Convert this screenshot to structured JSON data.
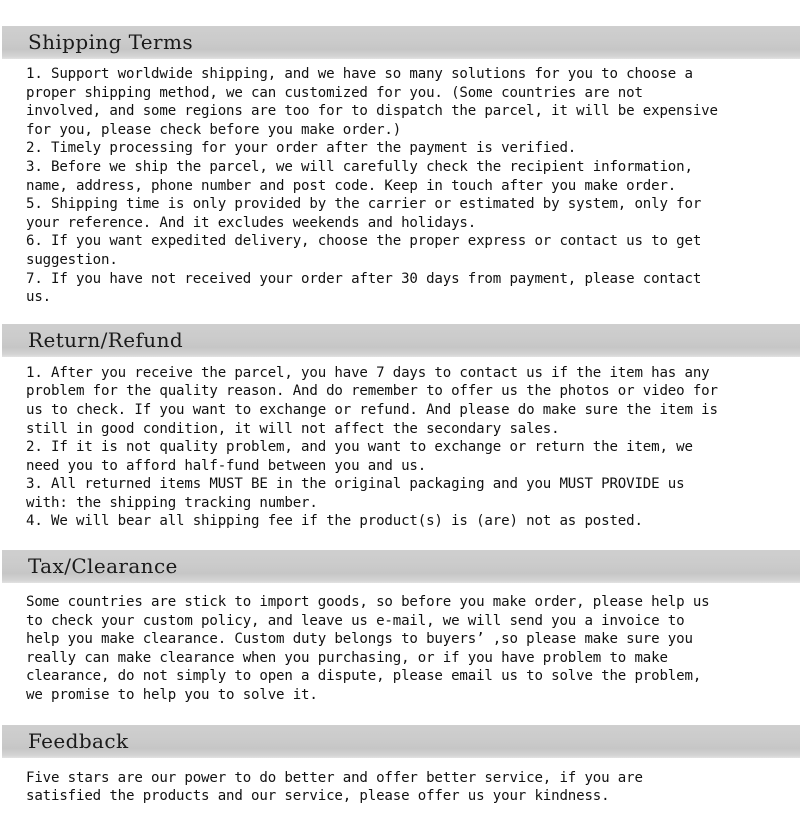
{
  "document": {
    "background_color": "#ffffff",
    "text_color": "#111111",
    "header_band_color": "#cbcbcb"
  },
  "sections": [
    {
      "id": "shipping",
      "title": "Shipping Terms",
      "lines": [
        "1. Support worldwide shipping, and we have so many solutions for you to choose a",
        "proper shipping method, we can customized for you. (Some countries are not",
        "involved, and some regions are too for to dispatch the parcel, it will be expensive",
        "for you, please check before you make order.)",
        "2. Timely processing for your order after the payment is verified.",
        "3. Before we ship the parcel, we will carefully check the recipient information,",
        "name, address, phone number and post code. Keep in touch after you make order.",
        "5. Shipping time is only provided by the carrier or estimated by system, only for",
        "your reference. And it excludes weekends and holidays.",
        "6. If you want expedited delivery, choose the proper express or contact us to get",
        "suggestion.",
        "7. If you have not received your order after 30 days from payment, please contact",
        "us."
      ]
    },
    {
      "id": "return",
      "title": "Return/Refund",
      "lines": [
        "1. After you receive the parcel, you have 7 days to contact us if the item has any",
        "problem for the quality reason. And do remember to offer us the photos or video for",
        "us to check. If you want to exchange or refund. And please do make sure the item is",
        "still in good condition, it will not affect the secondary sales.",
        "2. If it is not quality problem, and you want to exchange or return the item, we",
        "need you to afford half-fund between you and us.",
        "3. All returned items MUST BE in the original packaging and you MUST PROVIDE us",
        "with: the shipping tracking number.",
        "4. We will bear all shipping fee if the product(s) is (are) not as posted."
      ]
    },
    {
      "id": "tax",
      "title": "Tax/Clearance",
      "lines": [
        "Some countries are stick to import goods, so before you make order, please help us",
        "to check your custom policy, and leave us e-mail, we will send you a invoice to",
        "help you make clearance. Custom duty belongs to buyers’ ,so please make sure you",
        "really can make clearance when you purchasing, or if you have problem to make",
        "clearance, do not simply to open a dispute, please email us to solve the problem,",
        "we promise to help you to solve it."
      ]
    },
    {
      "id": "feedback",
      "title": "Feedback",
      "lines": [
        "Five stars are our power to do better and offer better service, if you are",
        "satisfied the products and our service, please offer us your kindness."
      ]
    }
  ]
}
